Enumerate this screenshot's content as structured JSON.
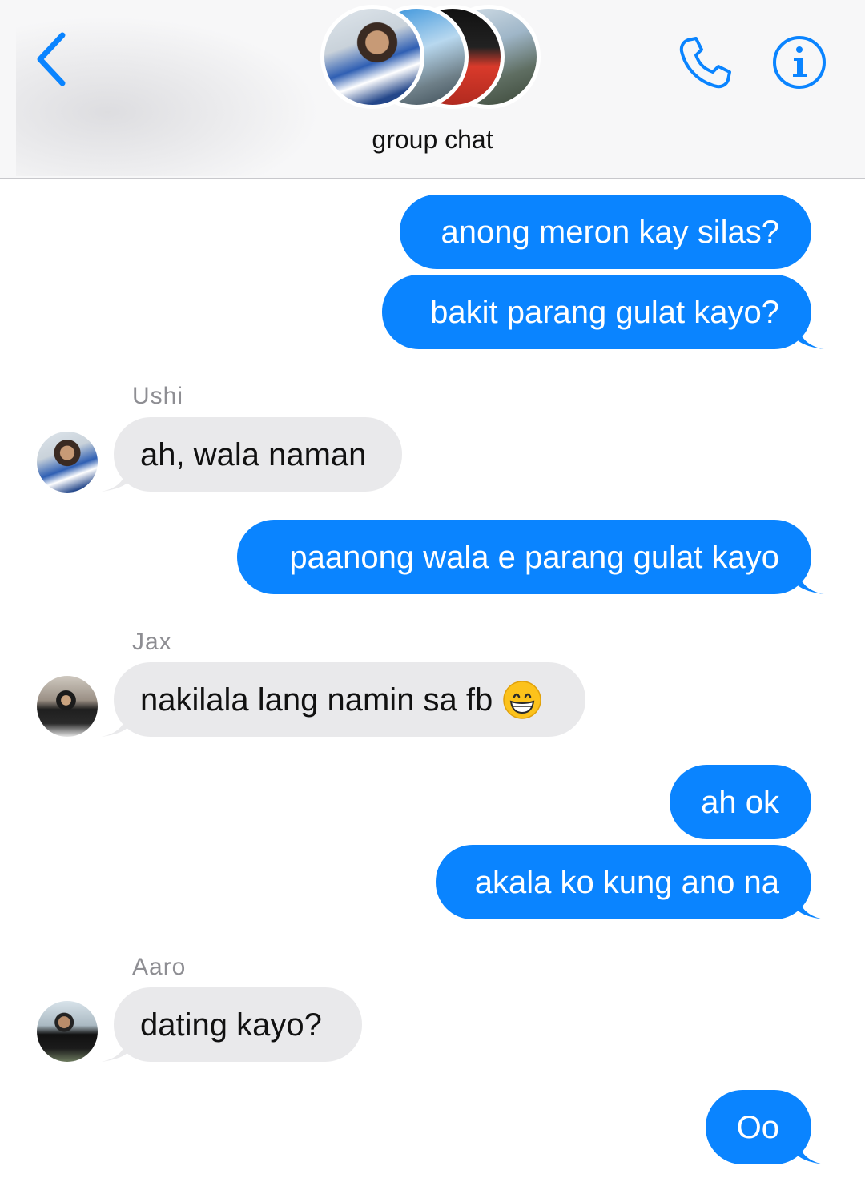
{
  "header": {
    "title": "group chat",
    "back_icon": "chevron-left-icon",
    "call_icon": "phone-icon",
    "info_icon": "info-icon",
    "accent": "#0a84ff"
  },
  "messages": [
    {
      "type": "sent",
      "text": "anong meron kay silas?"
    },
    {
      "type": "sent",
      "text": "bakit parang gulat kayo?"
    },
    {
      "type": "received",
      "sender": "Ushi",
      "text": "ah, wala naman"
    },
    {
      "type": "sent",
      "text": "paanong wala e parang gulat kayo"
    },
    {
      "type": "received",
      "sender": "Jax",
      "text": "nakilala lang namin sa fb",
      "emoji": "grinning-face-icon"
    },
    {
      "type": "sent",
      "text": "ah ok"
    },
    {
      "type": "sent",
      "text": "akala ko kung ano na"
    },
    {
      "type": "received",
      "sender": "Aaro",
      "text": "dating kayo?"
    },
    {
      "type": "sent",
      "text": "Oo"
    }
  ],
  "colors": {
    "sent_bubble": "#0a84ff",
    "received_bubble": "#e9e9eb",
    "sender_name": "#8e8e93"
  }
}
